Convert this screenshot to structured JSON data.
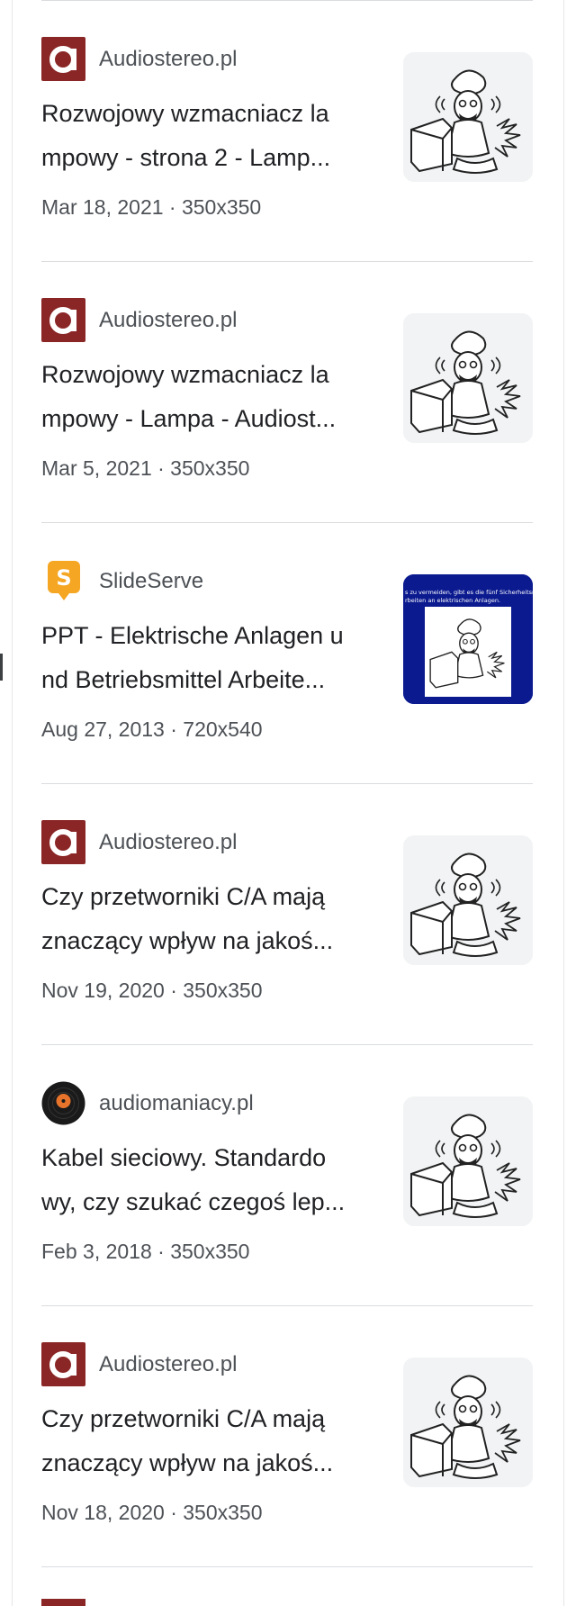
{
  "results": [
    {
      "source": "Audiostereo.pl",
      "source_icon": "audiostereo-logo-icon",
      "title_line1": "Rozwojowy wzmacniacz la",
      "title_line2": "mpowy - strona 2 - Lamp...",
      "meta": "Mar 18, 2021 · 350x350",
      "thumb_style": "light"
    },
    {
      "source": "Audiostereo.pl",
      "source_icon": "audiostereo-logo-icon",
      "title_line1": "Rozwojowy wzmacniacz la",
      "title_line2": "mpowy - Lampa - Audiost...",
      "meta": "Mar 5, 2021 · 350x350",
      "thumb_style": "light"
    },
    {
      "source": "SlideServe",
      "source_icon": "slideserve-logo-icon",
      "title_line1": "PPT - Elektrische Anlagen u",
      "title_line2": "nd Betriebsmittel Arbeite...",
      "meta": "Aug 27, 2013 · 720x540",
      "thumb_style": "dark",
      "thumb_text_line1": "s zu vermeiden, gibt es die fünf Sicherheitsrege",
      "thumb_text_line2": "rbeiten an elektrischen Anlagen."
    },
    {
      "source": "Audiostereo.pl",
      "source_icon": "audiostereo-logo-icon",
      "title_line1": "Czy przetworniki C/A mają",
      "title_line2": "znaczący wpływ na jakoś...",
      "meta": "Nov 19, 2020 · 350x350",
      "thumb_style": "light"
    },
    {
      "source": "audiomaniacy.pl",
      "source_icon": "vinyl-disc-icon",
      "title_line1": "Kabel sieciowy. Standardo",
      "title_line2": "wy, czy szukać czegoś lep...",
      "meta": "Feb 3, 2018 · 350x350",
      "thumb_style": "light"
    },
    {
      "source": "Audiostereo.pl",
      "source_icon": "audiostereo-logo-icon",
      "title_line1": "Czy przetworniki C/A mają",
      "title_line2": "znaczący wpływ na jakoś...",
      "meta": "Nov 18, 2020 · 350x350",
      "thumb_style": "light"
    }
  ],
  "colors": {
    "audiostereo_brand": "#8b2626",
    "slideserve_brand": "#f5a623",
    "divider": "#dadce0",
    "meta_text": "#4d5156"
  }
}
